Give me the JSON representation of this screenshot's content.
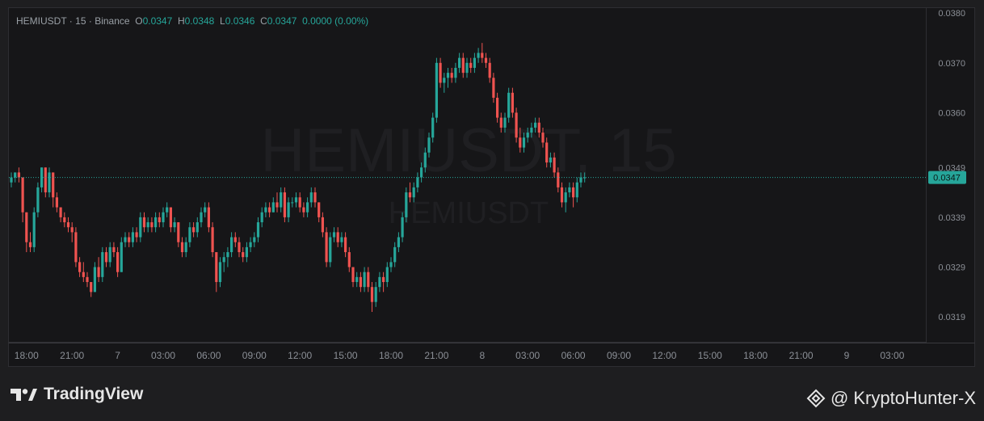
{
  "legend": {
    "symbol": "HEMIUSDT",
    "sep1": "·",
    "interval": "15",
    "sep2": "·",
    "exchange": "Binance",
    "o_label": "O",
    "o_value": "0.0347",
    "h_label": "H",
    "h_value": "0.0348",
    "l_label": "L",
    "l_value": "0.0346",
    "c_label": "C",
    "c_value": "0.0347",
    "change": "0.0000 (0.00%)"
  },
  "watermark": {
    "main": "HEMIUSDT, 15",
    "sub": "HEMIUSDT"
  },
  "branding": {
    "name": "TradingView"
  },
  "author": {
    "handle": "@ KryptoHunter-X"
  },
  "colors": {
    "up": "#26a69a",
    "down": "#ef5350",
    "current_price": "#26a69a",
    "background": "#161618"
  },
  "chart_data": {
    "type": "candlestick",
    "symbol": "HEMIUSDT",
    "interval": "15",
    "exchange": "Binance",
    "ylim": [
      0.0314,
      0.0381
    ],
    "y_ticks": [
      "0.0380",
      "0.0370",
      "0.0360",
      "0.0349",
      "0.0339",
      "0.0329",
      "0.0319"
    ],
    "y_tick_values": [
      0.038,
      0.037,
      0.036,
      0.0349,
      0.0339,
      0.0329,
      0.0319
    ],
    "current_price": 0.0347,
    "current_price_label": "0.0347",
    "x_ticks": [
      "18:00",
      "21:00",
      "7",
      "03:00",
      "06:00",
      "09:00",
      "12:00",
      "15:00",
      "18:00",
      "21:00",
      "8",
      "03:00",
      "06:00",
      "09:00",
      "12:00",
      "15:00",
      "18:00",
      "21:00",
      "9",
      "03:00"
    ],
    "x_tick_bar_index": [
      4,
      16,
      28,
      40,
      52,
      64,
      76,
      88,
      100,
      112,
      124,
      136,
      148,
      160,
      172,
      184,
      196,
      208,
      220,
      232
    ],
    "candles": [
      [
        0.0346,
        0.0348,
        0.0345,
        0.0347
      ],
      [
        0.0347,
        0.0348,
        0.0346,
        0.0348
      ],
      [
        0.0348,
        0.0349,
        0.0346,
        0.0347
      ],
      [
        0.0347,
        0.0347,
        0.0338,
        0.034
      ],
      [
        0.034,
        0.034,
        0.0332,
        0.0334
      ],
      [
        0.0334,
        0.0336,
        0.0332,
        0.0333
      ],
      [
        0.0333,
        0.0341,
        0.0332,
        0.034
      ],
      [
        0.034,
        0.0346,
        0.0339,
        0.0345
      ],
      [
        0.0345,
        0.0349,
        0.0344,
        0.0349
      ],
      [
        0.0349,
        0.0349,
        0.0343,
        0.0344
      ],
      [
        0.0344,
        0.0349,
        0.0343,
        0.0348
      ],
      [
        0.0348,
        0.0348,
        0.0341,
        0.0343
      ],
      [
        0.0343,
        0.0344,
        0.034,
        0.0341
      ],
      [
        0.0341,
        0.0341,
        0.0338,
        0.0339
      ],
      [
        0.0339,
        0.034,
        0.0337,
        0.0338
      ],
      [
        0.0338,
        0.0339,
        0.0336,
        0.0337
      ],
      [
        0.0337,
        0.0338,
        0.0334,
        0.0336
      ],
      [
        0.0336,
        0.0337,
        0.0329,
        0.033
      ],
      [
        0.033,
        0.0331,
        0.0327,
        0.0328
      ],
      [
        0.0328,
        0.033,
        0.0326,
        0.0327
      ],
      [
        0.0327,
        0.0328,
        0.0325,
        0.0326
      ],
      [
        0.0326,
        0.0326,
        0.0323,
        0.0324
      ],
      [
        0.0324,
        0.033,
        0.0324,
        0.0329
      ],
      [
        0.0329,
        0.0331,
        0.0326,
        0.0327
      ],
      [
        0.0327,
        0.0333,
        0.0326,
        0.0332
      ],
      [
        0.0332,
        0.0333,
        0.0329,
        0.033
      ],
      [
        0.033,
        0.0334,
        0.0329,
        0.0333
      ],
      [
        0.0333,
        0.0334,
        0.0331,
        0.0332
      ],
      [
        0.0332,
        0.0333,
        0.0327,
        0.0328
      ],
      [
        0.0328,
        0.0335,
        0.0328,
        0.0334
      ],
      [
        0.0334,
        0.0336,
        0.0333,
        0.0335
      ],
      [
        0.0335,
        0.0336,
        0.0333,
        0.0334
      ],
      [
        0.0334,
        0.0337,
        0.0333,
        0.0336
      ],
      [
        0.0336,
        0.0337,
        0.0334,
        0.0335
      ],
      [
        0.0335,
        0.034,
        0.0334,
        0.0339
      ],
      [
        0.0339,
        0.034,
        0.0336,
        0.0337
      ],
      [
        0.0337,
        0.0339,
        0.0336,
        0.0338
      ],
      [
        0.0338,
        0.0339,
        0.0336,
        0.0337
      ],
      [
        0.0337,
        0.034,
        0.0336,
        0.0339
      ],
      [
        0.0339,
        0.034,
        0.0337,
        0.0338
      ],
      [
        0.0338,
        0.0341,
        0.0337,
        0.034
      ],
      [
        0.034,
        0.0342,
        0.0339,
        0.0341
      ],
      [
        0.0341,
        0.0341,
        0.0336,
        0.0337
      ],
      [
        0.0337,
        0.0339,
        0.0336,
        0.0338
      ],
      [
        0.0338,
        0.0338,
        0.0333,
        0.0334
      ],
      [
        0.0334,
        0.0335,
        0.0331,
        0.0332
      ],
      [
        0.0332,
        0.0335,
        0.0331,
        0.0334
      ],
      [
        0.0334,
        0.0338,
        0.0333,
        0.0337
      ],
      [
        0.0337,
        0.0338,
        0.0335,
        0.0336
      ],
      [
        0.0336,
        0.0339,
        0.0335,
        0.0338
      ],
      [
        0.0338,
        0.0341,
        0.0337,
        0.034
      ],
      [
        0.034,
        0.0342,
        0.0339,
        0.0341
      ],
      [
        0.0341,
        0.0342,
        0.0336,
        0.0337
      ],
      [
        0.0337,
        0.0338,
        0.0331,
        0.0332
      ],
      [
        0.0332,
        0.0332,
        0.0324,
        0.0326
      ],
      [
        0.0326,
        0.0331,
        0.0325,
        0.033
      ],
      [
        0.033,
        0.0332,
        0.0328,
        0.0331
      ],
      [
        0.0331,
        0.0333,
        0.0329,
        0.0332
      ],
      [
        0.0332,
        0.0336,
        0.0331,
        0.0335
      ],
      [
        0.0335,
        0.0336,
        0.0333,
        0.0334
      ],
      [
        0.0334,
        0.0335,
        0.0331,
        0.0332
      ],
      [
        0.0332,
        0.0333,
        0.033,
        0.0331
      ],
      [
        0.0331,
        0.0334,
        0.033,
        0.0333
      ],
      [
        0.0333,
        0.0335,
        0.0332,
        0.0334
      ],
      [
        0.0334,
        0.0336,
        0.0333,
        0.0335
      ],
      [
        0.0335,
        0.0339,
        0.0334,
        0.0338
      ],
      [
        0.0338,
        0.0341,
        0.0337,
        0.034
      ],
      [
        0.034,
        0.0342,
        0.0339,
        0.0341
      ],
      [
        0.0341,
        0.0342,
        0.0339,
        0.034
      ],
      [
        0.034,
        0.0343,
        0.034,
        0.0342
      ],
      [
        0.0342,
        0.0344,
        0.034,
        0.0341
      ],
      [
        0.0341,
        0.0345,
        0.034,
        0.0344
      ],
      [
        0.0344,
        0.0345,
        0.0338,
        0.0339
      ],
      [
        0.0339,
        0.0343,
        0.0338,
        0.0342
      ],
      [
        0.0342,
        0.0343,
        0.0341,
        0.0342
      ],
      [
        0.0342,
        0.0344,
        0.0341,
        0.0343
      ],
      [
        0.0343,
        0.0344,
        0.034,
        0.0341
      ],
      [
        0.0341,
        0.0342,
        0.0339,
        0.034
      ],
      [
        0.034,
        0.0343,
        0.0339,
        0.0342
      ],
      [
        0.0342,
        0.0345,
        0.0341,
        0.0344
      ],
      [
        0.0344,
        0.0345,
        0.0341,
        0.0342
      ],
      [
        0.0342,
        0.0342,
        0.0338,
        0.0339
      ],
      [
        0.0339,
        0.034,
        0.0335,
        0.0336
      ],
      [
        0.0336,
        0.0337,
        0.0329,
        0.033
      ],
      [
        0.033,
        0.0336,
        0.0329,
        0.0335
      ],
      [
        0.0335,
        0.0337,
        0.0334,
        0.0336
      ],
      [
        0.0336,
        0.0337,
        0.0333,
        0.0334
      ],
      [
        0.0334,
        0.0336,
        0.0333,
        0.0335
      ],
      [
        0.0335,
        0.0336,
        0.0331,
        0.0332
      ],
      [
        0.0332,
        0.0333,
        0.0328,
        0.0329
      ],
      [
        0.0329,
        0.0329,
        0.0325,
        0.0326
      ],
      [
        0.0326,
        0.0328,
        0.0325,
        0.0327
      ],
      [
        0.0327,
        0.0328,
        0.0324,
        0.0325
      ],
      [
        0.0325,
        0.0329,
        0.0324,
        0.0328
      ],
      [
        0.0328,
        0.0329,
        0.0324,
        0.0325
      ],
      [
        0.0325,
        0.0326,
        0.032,
        0.0322
      ],
      [
        0.0322,
        0.0326,
        0.0321,
        0.0325
      ],
      [
        0.0325,
        0.0328,
        0.0324,
        0.0327
      ],
      [
        0.0327,
        0.0328,
        0.0324,
        0.0326
      ],
      [
        0.0326,
        0.033,
        0.0325,
        0.0329
      ],
      [
        0.0329,
        0.0331,
        0.0328,
        0.033
      ],
      [
        0.033,
        0.0334,
        0.0329,
        0.0333
      ],
      [
        0.0333,
        0.0336,
        0.0332,
        0.0335
      ],
      [
        0.0335,
        0.034,
        0.0334,
        0.0339
      ],
      [
        0.0339,
        0.0345,
        0.0338,
        0.0344
      ],
      [
        0.0344,
        0.0346,
        0.0342,
        0.0343
      ],
      [
        0.0343,
        0.0346,
        0.0342,
        0.0345
      ],
      [
        0.0345,
        0.0348,
        0.0344,
        0.0347
      ],
      [
        0.0347,
        0.035,
        0.0346,
        0.0349
      ],
      [
        0.0349,
        0.0353,
        0.0348,
        0.0352
      ],
      [
        0.0352,
        0.0356,
        0.0351,
        0.0355
      ],
      [
        0.0355,
        0.036,
        0.0354,
        0.0359
      ],
      [
        0.0359,
        0.0371,
        0.0358,
        0.037
      ],
      [
        0.037,
        0.0371,
        0.0365,
        0.0366
      ],
      [
        0.0366,
        0.0368,
        0.0364,
        0.0367
      ],
      [
        0.0367,
        0.0369,
        0.0365,
        0.0368
      ],
      [
        0.0368,
        0.0369,
        0.0366,
        0.0367
      ],
      [
        0.0367,
        0.037,
        0.0366,
        0.0369
      ],
      [
        0.0369,
        0.0372,
        0.0368,
        0.0371
      ],
      [
        0.0371,
        0.0372,
        0.0367,
        0.0368
      ],
      [
        0.0368,
        0.0371,
        0.0367,
        0.037
      ],
      [
        0.037,
        0.0371,
        0.0368,
        0.0369
      ],
      [
        0.0369,
        0.0372,
        0.0368,
        0.0371
      ],
      [
        0.0371,
        0.0373,
        0.037,
        0.0372
      ],
      [
        0.0372,
        0.0374,
        0.037,
        0.0371
      ],
      [
        0.0371,
        0.0372,
        0.0369,
        0.037
      ],
      [
        0.037,
        0.0371,
        0.0366,
        0.0367
      ],
      [
        0.0367,
        0.0368,
        0.0362,
        0.0363
      ],
      [
        0.0363,
        0.0364,
        0.0358,
        0.0359
      ],
      [
        0.0359,
        0.036,
        0.0356,
        0.0357
      ],
      [
        0.0357,
        0.036,
        0.0356,
        0.0359
      ],
      [
        0.0359,
        0.0365,
        0.0358,
        0.0364
      ],
      [
        0.0364,
        0.0365,
        0.0359,
        0.036
      ],
      [
        0.036,
        0.0361,
        0.0354,
        0.0355
      ],
      [
        0.0355,
        0.0357,
        0.0352,
        0.0353
      ],
      [
        0.0353,
        0.0356,
        0.0352,
        0.0355
      ],
      [
        0.0355,
        0.0357,
        0.0354,
        0.0356
      ],
      [
        0.0356,
        0.0358,
        0.0355,
        0.0357
      ],
      [
        0.0357,
        0.0359,
        0.0356,
        0.0358
      ],
      [
        0.0358,
        0.0359,
        0.0355,
        0.0356
      ],
      [
        0.0356,
        0.0357,
        0.0353,
        0.0354
      ],
      [
        0.0354,
        0.0355,
        0.0349,
        0.035
      ],
      [
        0.035,
        0.0352,
        0.0349,
        0.0351
      ],
      [
        0.0351,
        0.0352,
        0.0347,
        0.0348
      ],
      [
        0.0348,
        0.0349,
        0.0344,
        0.0345
      ],
      [
        0.0345,
        0.0346,
        0.0341,
        0.0342
      ],
      [
        0.0342,
        0.0345,
        0.034,
        0.0344
      ],
      [
        0.0344,
        0.0346,
        0.0343,
        0.0345
      ],
      [
        0.0345,
        0.0346,
        0.0341,
        0.0343
      ],
      [
        0.0343,
        0.0347,
        0.0342,
        0.0346
      ],
      [
        0.0346,
        0.0348,
        0.0345,
        0.0347
      ],
      [
        0.0347,
        0.0348,
        0.0346,
        0.0347
      ]
    ]
  }
}
